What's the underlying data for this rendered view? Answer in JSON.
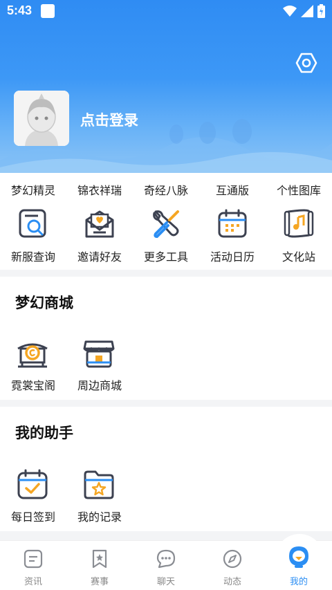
{
  "status_bar": {
    "time": "5:43"
  },
  "profile": {
    "login_label": "点击登录"
  },
  "quick_links": [
    "梦幻精灵",
    "锦衣祥瑞",
    "奇经八脉",
    "互通版",
    "个性图库"
  ],
  "tools": [
    {
      "label": "新服查询",
      "icon": "search-server-icon"
    },
    {
      "label": "邀请好友",
      "icon": "invite-letter-icon"
    },
    {
      "label": "更多工具",
      "icon": "tools-icon"
    },
    {
      "label": "活动日历",
      "icon": "calendar-icon"
    },
    {
      "label": "文化站",
      "icon": "music-scroll-icon"
    }
  ],
  "mall": {
    "title": "梦幻商城",
    "items": [
      {
        "label": "霓裳宝阁",
        "icon": "treasure-pavilion-icon"
      },
      {
        "label": "周边商城",
        "icon": "shop-icon"
      }
    ]
  },
  "assistant": {
    "title": "我的助手",
    "items": [
      {
        "label": "每日签到",
        "icon": "checkin-calendar-icon"
      },
      {
        "label": "我的记录",
        "icon": "record-folder-icon"
      }
    ]
  },
  "bottom_nav": [
    {
      "label": "资讯",
      "icon": "news-icon",
      "active": false
    },
    {
      "label": "赛事",
      "icon": "bookmark-star-icon",
      "active": false
    },
    {
      "label": "聊天",
      "icon": "chat-icon",
      "active": false
    },
    {
      "label": "动态",
      "icon": "compass-icon",
      "active": false
    },
    {
      "label": "我的",
      "icon": "mascot-icon",
      "active": true
    }
  ],
  "colors": {
    "accent": "#2b8ef3",
    "icon_orange": "#f5a623",
    "icon_dark": "#3c4150"
  }
}
